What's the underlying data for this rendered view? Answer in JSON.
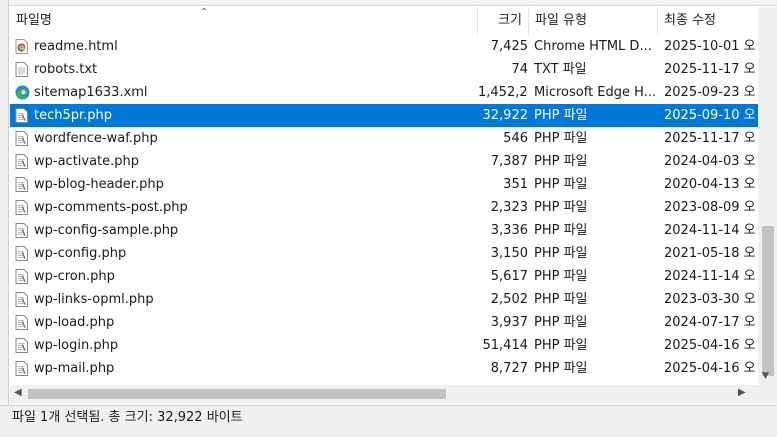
{
  "columns": {
    "name": "파일명",
    "size": "크기",
    "type": "파일 유형",
    "modified": "최종 수정"
  },
  "files": [
    {
      "name": "readme.html",
      "size": "7,425",
      "type": "Chrome HTML D...",
      "modified": "2025-10-01 오",
      "icon": "chrome-html-icon",
      "selected": false
    },
    {
      "name": "robots.txt",
      "size": "74",
      "type": "TXT 파일",
      "modified": "2025-11-17 오",
      "icon": "text-file-icon",
      "selected": false
    },
    {
      "name": "sitemap1633.xml",
      "size": "1,452,256",
      "type": "Microsoft Edge H...",
      "modified": "2025-09-23 오",
      "icon": "edge-icon",
      "selected": false
    },
    {
      "name": "tech5pr.php",
      "size": "32,922",
      "type": "PHP 파일",
      "modified": "2025-09-10 오",
      "icon": "php-file-icon",
      "selected": true
    },
    {
      "name": "wordfence-waf.php",
      "size": "546",
      "type": "PHP 파일",
      "modified": "2025-11-17 오",
      "icon": "php-file-icon",
      "selected": false
    },
    {
      "name": "wp-activate.php",
      "size": "7,387",
      "type": "PHP 파일",
      "modified": "2024-04-03 오",
      "icon": "php-file-icon",
      "selected": false
    },
    {
      "name": "wp-blog-header.php",
      "size": "351",
      "type": "PHP 파일",
      "modified": "2020-04-13 오",
      "icon": "php-file-icon",
      "selected": false
    },
    {
      "name": "wp-comments-post.php",
      "size": "2,323",
      "type": "PHP 파일",
      "modified": "2023-08-09 오",
      "icon": "php-file-icon",
      "selected": false
    },
    {
      "name": "wp-config-sample.php",
      "size": "3,336",
      "type": "PHP 파일",
      "modified": "2024-11-14 오",
      "icon": "php-file-icon",
      "selected": false
    },
    {
      "name": "wp-config.php",
      "size": "3,150",
      "type": "PHP 파일",
      "modified": "2021-05-18 오",
      "icon": "php-file-icon",
      "selected": false
    },
    {
      "name": "wp-cron.php",
      "size": "5,617",
      "type": "PHP 파일",
      "modified": "2024-11-14 오",
      "icon": "php-file-icon",
      "selected": false
    },
    {
      "name": "wp-links-opml.php",
      "size": "2,502",
      "type": "PHP 파일",
      "modified": "2023-03-30 오",
      "icon": "php-file-icon",
      "selected": false
    },
    {
      "name": "wp-load.php",
      "size": "3,937",
      "type": "PHP 파일",
      "modified": "2024-07-17 오",
      "icon": "php-file-icon",
      "selected": false
    },
    {
      "name": "wp-login.php",
      "size": "51,414",
      "type": "PHP 파일",
      "modified": "2025-04-16 오",
      "icon": "php-file-icon",
      "selected": false
    },
    {
      "name": "wp-mail.php",
      "size": "8,727",
      "type": "PHP 파일",
      "modified": "2025-04-16 오",
      "icon": "php-file-icon",
      "selected": false
    }
  ],
  "status": {
    "text": "파일 1개 선택됨. 총 크기: 32,922 바이트"
  },
  "colors": {
    "selection": "#0078d7",
    "chrome_red": "#db4437",
    "chrome_yellow": "#f4b400",
    "chrome_green": "#0f9d58",
    "edge_blue": "#1f8ad8",
    "edge_green": "#38b24a"
  }
}
